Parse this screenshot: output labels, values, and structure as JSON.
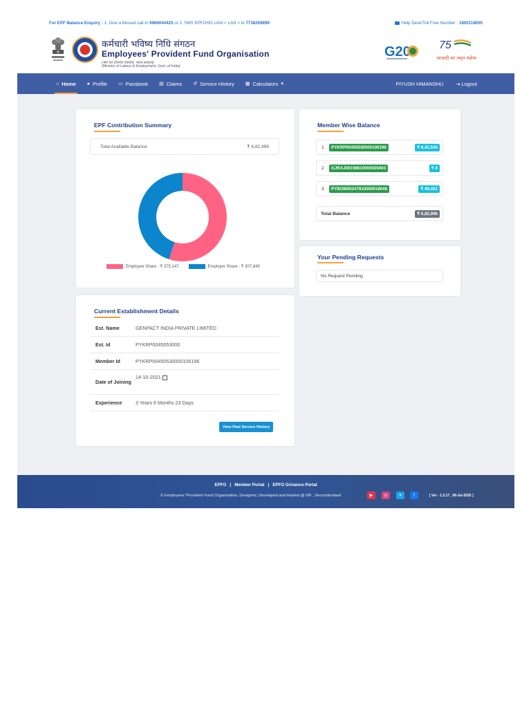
{
  "topbar": {
    "enquiry_label": "For EPF Balance Enquiry :",
    "enquiry_text_1": " 1. Give a Missed call to ",
    "missed_call_number": "9966044425",
    "enquiry_text_2": " or 2. SMS EPFOHO UAN < LAN > to ",
    "sms_number": "7738299899",
    "helpdesk_text": "Help Desk/Toll Free Number : ",
    "helpdesk_number": "1800118005"
  },
  "header": {
    "org_hindi": "कर्मचारी भविष्य निधि संगठन",
    "org_english": "Employees' Provident Fund Organisation",
    "ministry_hindi": "(श्रम एवं रोजगार मंत्रालय, भारत सरकार)",
    "ministry_english": "(Ministry of Labour & Employment, Govt. of India)",
    "g20_text": "G20",
    "azadi_text": "आज़ादी का अमृत महोत्सव",
    "azadi_number": "75"
  },
  "nav": {
    "items": [
      {
        "label": "Home",
        "icon": "home-icon"
      },
      {
        "label": "Profile",
        "icon": "user-icon"
      },
      {
        "label": "Passbook",
        "icon": "passbook-icon"
      },
      {
        "label": "Claims",
        "icon": "document-icon"
      },
      {
        "label": "Service History",
        "icon": "history-icon"
      },
      {
        "label": "Calculators",
        "icon": "calculator-icon"
      }
    ],
    "user_name": "PIYUSH HIMANSHU",
    "logout_label": "Logout"
  },
  "epf_summary": {
    "title": "EPF Contribution Summary",
    "total_label": "Total Available Balance",
    "total_value": "₹ 6,82,996",
    "legend_employee": "Employee Share : ₹ 375,147",
    "legend_employer": "Employer Share : ₹ 307,849",
    "employee_share": 375147,
    "employer_share": 307849,
    "employee_color": "#ff6384",
    "employer_color": "#0c85cd"
  },
  "establishment": {
    "title": "Current Establishment Details",
    "rows": [
      {
        "label": "Est. Name",
        "value": "GENPACT INDIA PRIVATE LIMITED"
      },
      {
        "label": "Est. Id",
        "value": "PYKRP0045053000"
      },
      {
        "label": "Member Id",
        "value": "PYKRP00450530000106196"
      },
      {
        "label": "Date of Joining",
        "value": "14-10-2021"
      },
      {
        "label": "Experience",
        "value": "3 Years 6 Months 23 Days"
      }
    ],
    "history_button": "View Past Service History"
  },
  "member_balance": {
    "title": "Member Wise Balance",
    "rows": [
      {
        "num": "1",
        "uan": "PYKRP00450530000106196",
        "amount": "₹ 6,42,545"
      },
      {
        "num": "2",
        "uan": "GJRAJ00198610000029403",
        "amount": "₹ 0"
      },
      {
        "num": "3",
        "uan": "PYBOM00247810000018048",
        "amount": "₹ 40,451"
      }
    ],
    "total_label": "Total Balance",
    "total_amount": "₹ 6,82,996"
  },
  "pending": {
    "title": "Your Pending Requests",
    "status": "No Request Pending"
  },
  "footer": {
    "link_epfo": "EPFO",
    "link_member": "Member Portal",
    "link_grievance": "EPFO Grivance Portal",
    "separator": "|",
    "copyright": "© Employees' Provident Fund Organisation, Designed, Developed and Hosted @ DR , Secunderabad",
    "version": "[ Ver - 1.2.17 , 08-Jul-2025 ]"
  }
}
